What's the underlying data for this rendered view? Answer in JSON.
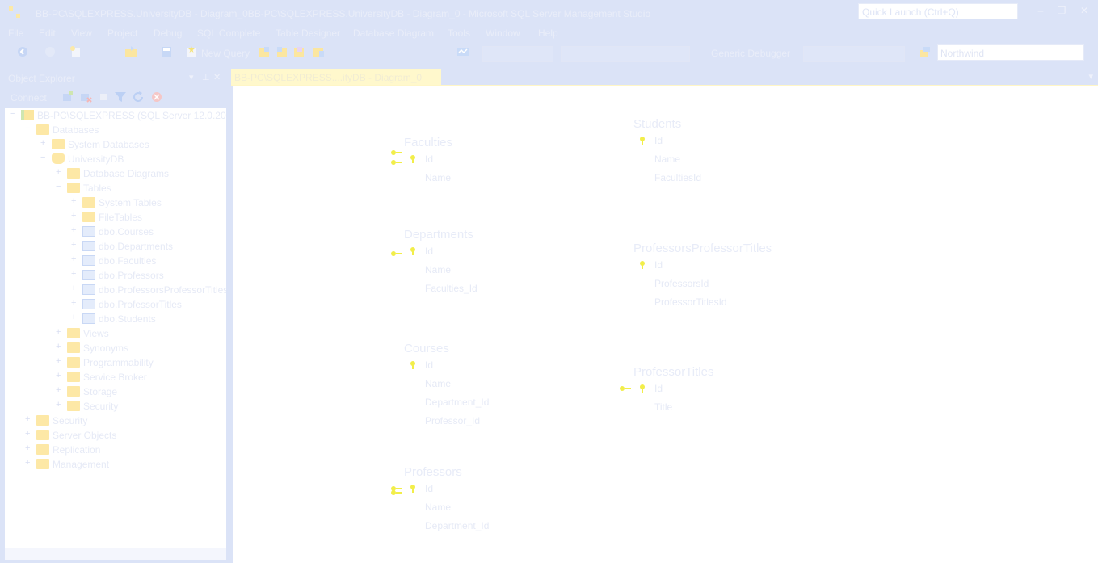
{
  "window": {
    "title": "BB-PC\\SQLEXPRESS.UniversityDB - Diagram_0BB-PC\\SQLEXPRESS.UniversityDB - Diagram_0 - Microsoft SQL Server Management Studio",
    "quick_launch_placeholder": "Quick Launch (Ctrl+Q)"
  },
  "menu": [
    "File",
    "Edit",
    "View",
    "Project",
    "Debug",
    "SQL Complete",
    "Table Designer",
    "Database Diagram",
    "Tools",
    "Window",
    "Help"
  ],
  "toolbar": {
    "new_query_label": "New Query",
    "debugger_label": "Generic Debugger",
    "database_value": "Northwind"
  },
  "object_explorer": {
    "title": "Object Explorer",
    "connect_label": "Connect",
    "tree": [
      {
        "label": "BB-PC\\SQLEXPRESS (SQL Server 12.0.2000 - BB",
        "level": 0,
        "exp": "−",
        "icon": "server"
      },
      {
        "label": "Databases",
        "level": 1,
        "exp": "−",
        "icon": "folder"
      },
      {
        "label": "System Databases",
        "level": 2,
        "exp": "+",
        "icon": "folder"
      },
      {
        "label": "UniversityDB",
        "level": 2,
        "exp": "−",
        "icon": "database"
      },
      {
        "label": "Database Diagrams",
        "level": 3,
        "exp": "+",
        "icon": "folder"
      },
      {
        "label": "Tables",
        "level": 3,
        "exp": "−",
        "icon": "folder"
      },
      {
        "label": "System Tables",
        "level": 4,
        "exp": "+",
        "icon": "folder"
      },
      {
        "label": "FileTables",
        "level": 4,
        "exp": "+",
        "icon": "folder"
      },
      {
        "label": "dbo.Courses",
        "level": 4,
        "exp": "+",
        "icon": "table"
      },
      {
        "label": "dbo.Departments",
        "level": 4,
        "exp": "+",
        "icon": "table"
      },
      {
        "label": "dbo.Faculties",
        "level": 4,
        "exp": "+",
        "icon": "table"
      },
      {
        "label": "dbo.Professors",
        "level": 4,
        "exp": "+",
        "icon": "table"
      },
      {
        "label": "dbo.ProfessorsProfessorTitles",
        "level": 4,
        "exp": "+",
        "icon": "table"
      },
      {
        "label": "dbo.ProfessorTitles",
        "level": 4,
        "exp": "+",
        "icon": "table"
      },
      {
        "label": "dbo.Students",
        "level": 4,
        "exp": "+",
        "icon": "table"
      },
      {
        "label": "Views",
        "level": 3,
        "exp": "+",
        "icon": "folder"
      },
      {
        "label": "Synonyms",
        "level": 3,
        "exp": "+",
        "icon": "folder"
      },
      {
        "label": "Programmability",
        "level": 3,
        "exp": "+",
        "icon": "folder"
      },
      {
        "label": "Service Broker",
        "level": 3,
        "exp": "+",
        "icon": "folder"
      },
      {
        "label": "Storage",
        "level": 3,
        "exp": "+",
        "icon": "folder"
      },
      {
        "label": "Security",
        "level": 3,
        "exp": "+",
        "icon": "folder"
      },
      {
        "label": "Security",
        "level": 1,
        "exp": "+",
        "icon": "folder"
      },
      {
        "label": "Server Objects",
        "level": 1,
        "exp": "+",
        "icon": "folder"
      },
      {
        "label": "Replication",
        "level": 1,
        "exp": "+",
        "icon": "folder"
      },
      {
        "label": "Management",
        "level": 1,
        "exp": "+",
        "icon": "folder"
      }
    ]
  },
  "document": {
    "tab_label": "BB-PC\\SQLEXPRESS....ityDB - Diagram_0",
    "tables": [
      {
        "id": "faculties",
        "name": "Faculties",
        "columns": [
          {
            "name": "Id",
            "key": true
          },
          {
            "name": "Name",
            "key": false
          }
        ]
      },
      {
        "id": "students",
        "name": "Students",
        "columns": [
          {
            "name": "Id",
            "key": true
          },
          {
            "name": "Name",
            "key": false
          },
          {
            "name": "FacultiesId",
            "key": false
          }
        ]
      },
      {
        "id": "departments",
        "name": "Departments",
        "columns": [
          {
            "name": "Id",
            "key": true
          },
          {
            "name": "Name",
            "key": false
          },
          {
            "name": "Faculties_Id",
            "key": false
          }
        ]
      },
      {
        "id": "professorsprofessortitles",
        "name": "ProfessorsProfessorTitles",
        "columns": [
          {
            "name": "Id",
            "key": true
          },
          {
            "name": "ProfessorsId",
            "key": false
          },
          {
            "name": "ProfessorTitlesId",
            "key": false
          }
        ]
      },
      {
        "id": "courses",
        "name": "Courses",
        "columns": [
          {
            "name": "Id",
            "key": true
          },
          {
            "name": "Name",
            "key": false
          },
          {
            "name": "Department_Id",
            "key": false
          },
          {
            "name": "Professor_Id",
            "key": false
          }
        ]
      },
      {
        "id": "professortitles",
        "name": "ProfessorTitles",
        "columns": [
          {
            "name": "Id",
            "key": true
          },
          {
            "name": "Title",
            "key": false
          }
        ]
      },
      {
        "id": "professors",
        "name": "Professors",
        "columns": [
          {
            "name": "Id",
            "key": true
          },
          {
            "name": "Name",
            "key": false
          },
          {
            "name": "Department_Id",
            "key": false
          }
        ]
      }
    ]
  }
}
